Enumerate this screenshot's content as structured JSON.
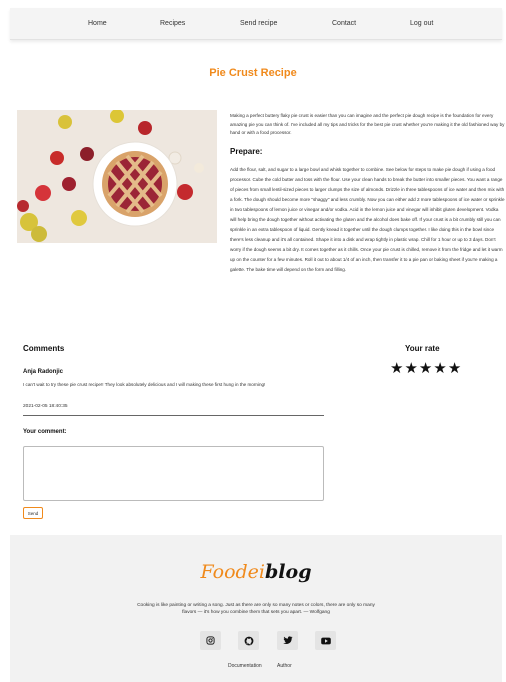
{
  "nav": {
    "items": [
      "Home",
      "Recipes",
      "Send recipe",
      "Contact",
      "Log out"
    ]
  },
  "recipe": {
    "title": "Pie Crust Recipe",
    "intro": "Making a perfect buttery flaky pie crust is easier than you can imagine and the perfect pie dough recipe is the foundation for every amazing pie you can think of. I've included all my tips and tricks for the best pie crust whether you're making it the old fashioned way by hand or with a food processor.",
    "prepare_heading": "Prepare:",
    "prepare_text": "Add the flour, salt, and sugar to a large bowl and whisk together to combine. See below for steps to make pie dough if using a food processor. Cube the cold butter and toss with the flour. Use your clean hands to break the butter into smaller pieces. You want a range of pieces from small lentil-sized pieces to larger clumps the size of almonds. Drizzle in three tablespoons of ice water and then mix with a fork. The dough should become more \"shaggy\" and less crumbly. Now you can either add 2 more tablespoons of ice water or sprinkle in two tablespoons of lemon juice or vinegar and/or vodka. Acid in the lemon juice and vinegar will inhibit gluten development. Vodka will help bring the dough together without activating the gluten and the alcohol does bake off. If your crust is a bit crumbly still you can sprinkle in an extra tablespoon of liquid. Gently knead it together until the dough clumps together. I like doing this in the bowl since there's less cleanup and it's all contained. Shape it into a disk and wrap tightly in plastic wrap. Chill for 1 hour or up to 3 days. Don't worry if the dough seems a bit dry. It comes together as it chills. Once your pie crust is chilled, remove it from the fridge and let it warm up on the counter for a few minutes. Roll it out to about 1/4 of an inch, then transfer it to a pie pan or baking sheet if you're making a galette. The bake time will depend on the form and filling."
  },
  "comments": {
    "heading": "Comments",
    "items": [
      {
        "author": "Anja Radonjic",
        "text": "I can't wait to try these pie crust recipe!! They look absolutely delicious and I will making these first hung in the morning!",
        "date": "2021-02-05 18:40:35"
      }
    ],
    "your_comment_label": "Your comment:",
    "textarea_placeholder": "",
    "send_label": "Send"
  },
  "rating": {
    "heading": "Your rate",
    "stars": 5,
    "max": 5,
    "star_glyph": "★"
  },
  "footer": {
    "logo_part1": "Foodei",
    "logo_part2": "blog",
    "quote": "Cooking is like painting or writing a song. Just as there are only so many notes or colors, there are only so many flavors — it's how you combine them that sets you apart. — Wolfgang",
    "socials": [
      "instagram-icon",
      "github-icon",
      "twitter-icon",
      "youtube-icon"
    ],
    "links": [
      "Documentation",
      "Author"
    ]
  },
  "colors": {
    "accent": "#f08a1c",
    "footer_bg": "#f2f2f2",
    "nav_bg": "#f4f4f4"
  }
}
